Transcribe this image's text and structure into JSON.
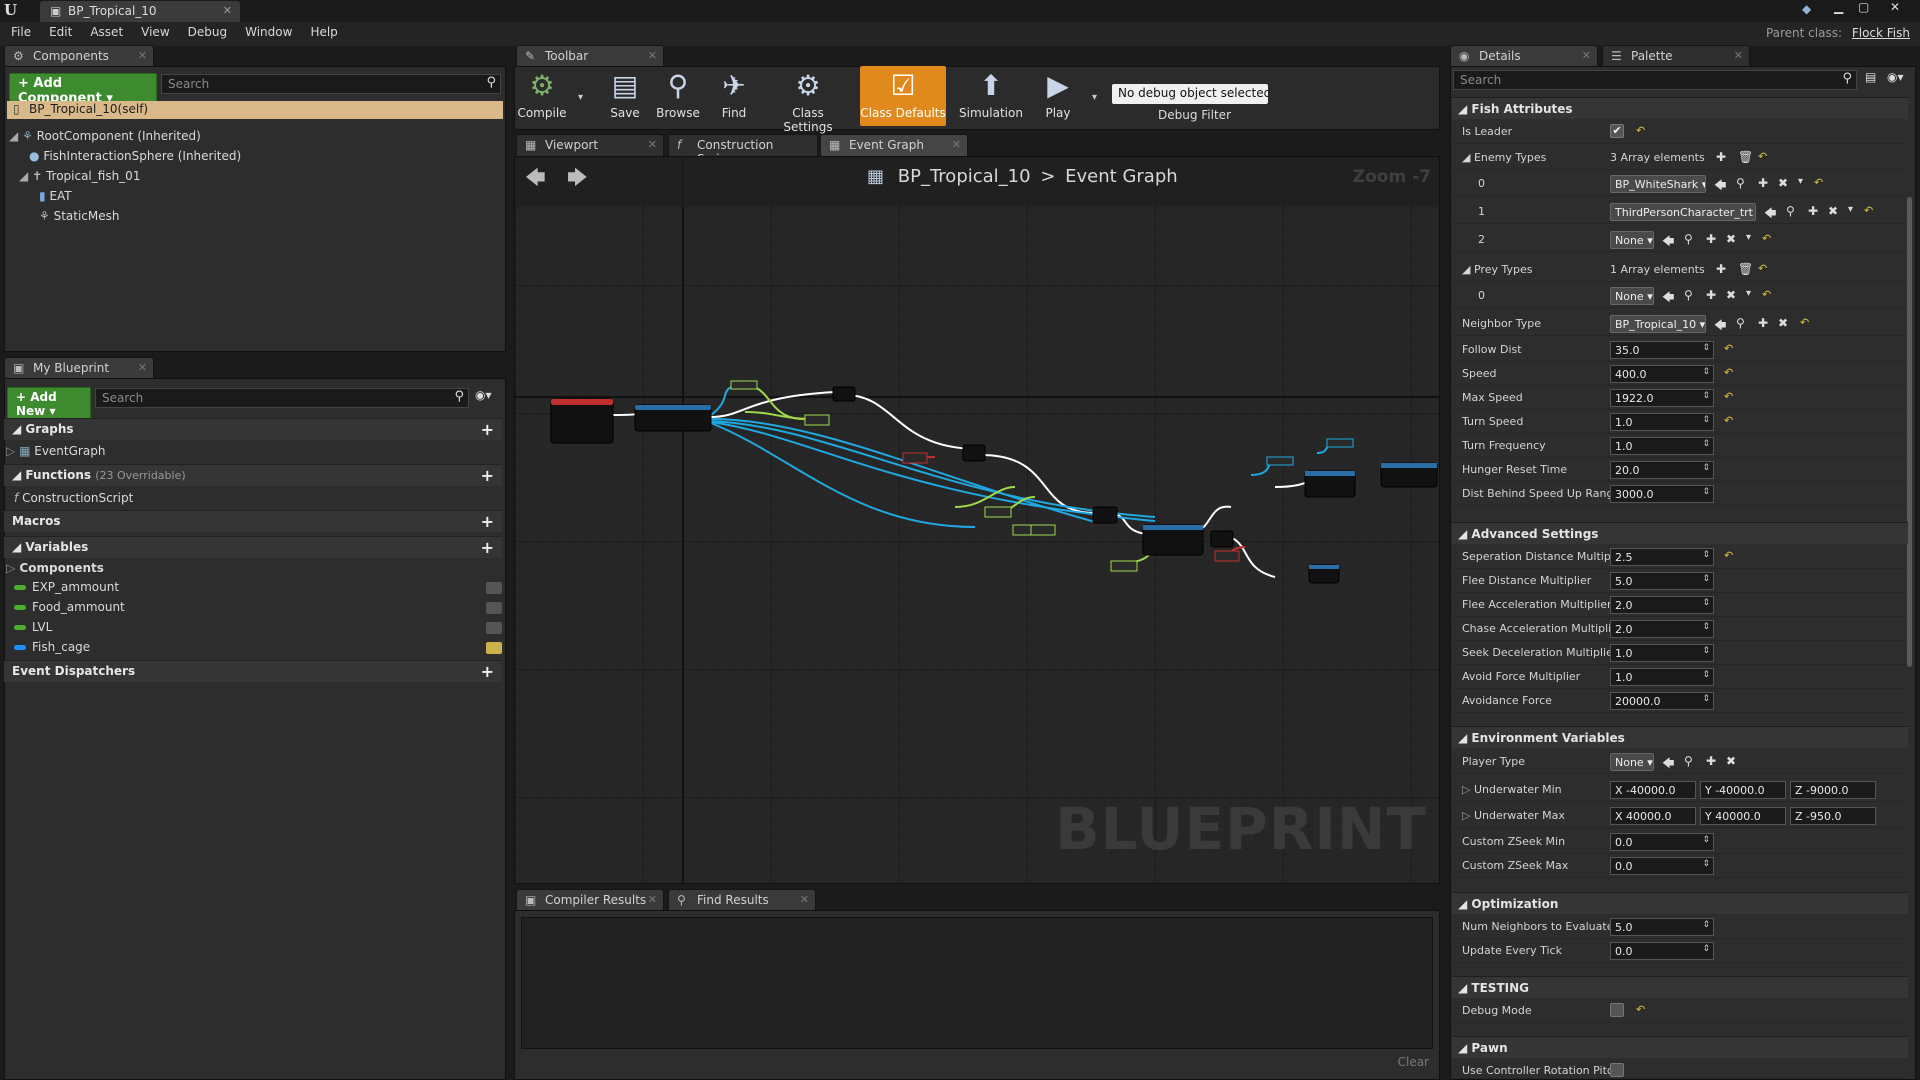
{
  "window": {
    "tab_title": "BP_Tropical_10",
    "parent_class_label": "Parent class:",
    "parent_class_value": "Flock Fish"
  },
  "menu": [
    "File",
    "Edit",
    "Asset",
    "View",
    "Debug",
    "Window",
    "Help"
  ],
  "components_panel": {
    "tab": "Components",
    "add_button": "+ Add Component ▾",
    "search_placeholder": "Search",
    "self_item": "BP_Tropical_10(self)",
    "tree": [
      "RootComponent (Inherited)",
      "FishInteractionSphere (Inherited)",
      "Tropical_fish_01",
      "EAT",
      "StaticMesh"
    ]
  },
  "my_blueprint": {
    "tab": "My Blueprint",
    "add_new": "+ Add New ▾",
    "search_placeholder": "Search",
    "graphs_label": "Graphs",
    "event_graph": "EventGraph",
    "functions_label": "Functions",
    "functions_count": "(23 Overridable)",
    "construction_script": "ConstructionScript",
    "macros_label": "Macros",
    "variables_label": "Variables",
    "components_label": "Components",
    "variables": [
      {
        "name": "EXP_ammount",
        "color": "#4caf2e"
      },
      {
        "name": "Food_ammount",
        "color": "#4caf2e"
      },
      {
        "name": "LVL",
        "color": "#4caf2e"
      },
      {
        "name": "Fish_cage",
        "color": "#1e90ff"
      }
    ],
    "event_dispatchers_label": "Event Dispatchers"
  },
  "toolbar": {
    "tab": "Toolbar",
    "buttons": [
      "Compile",
      "Save",
      "Browse",
      "Find",
      "Class Settings",
      "Class Defaults",
      "Simulation",
      "Play"
    ],
    "debug_select": "No debug object selected ▾",
    "debug_filter_label": "Debug Filter"
  },
  "graph_tabs": [
    "Viewport",
    "Construction Scrip",
    "Event Graph"
  ],
  "graph": {
    "breadcrumb_root": "BP_Tropical_10",
    "breadcrumb_sep": ">",
    "breadcrumb_leaf": "Event Graph",
    "zoom": "Zoom -7",
    "watermark": "BLUEPRINT"
  },
  "bottom_tabs": [
    "Compiler Results",
    "Find Results"
  ],
  "bottom_clear": "Clear",
  "details": {
    "tab_details": "Details",
    "tab_palette": "Palette",
    "search_placeholder": "Search",
    "sections": {
      "fish_attributes": "Fish Attributes",
      "advanced_settings": "Advanced Settings",
      "environment_variables": "Environment Variables",
      "optimization": "Optimization",
      "testing": "TESTING",
      "pawn": "Pawn"
    },
    "is_leader_label": "Is Leader",
    "enemy_types_label": "Enemy Types",
    "enemy_types_count": "3 Array elements",
    "enemy_items": [
      {
        "index": "0",
        "value": "BP_WhiteShark ▾"
      },
      {
        "index": "1",
        "value": "ThirdPersonCharacter_trt ▾"
      },
      {
        "index": "2",
        "value": "None ▾"
      }
    ],
    "prey_types_label": "Prey Types",
    "prey_types_count": "1 Array elements",
    "prey_items": [
      {
        "index": "0",
        "value": "None ▾"
      }
    ],
    "neighbor_type_label": "Neighbor Type",
    "neighbor_type_value": "BP_Tropical_10 ▾",
    "fish_numbers": [
      {
        "label": "Follow Dist",
        "value": "35.0"
      },
      {
        "label": "Speed",
        "value": "400.0"
      },
      {
        "label": "Max Speed",
        "value": "1922.0"
      },
      {
        "label": "Turn Speed",
        "value": "1.0"
      },
      {
        "label": "Turn Frequency",
        "value": "1.0"
      },
      {
        "label": "Hunger Reset Time",
        "value": "20.0"
      },
      {
        "label": "Dist Behind Speed Up Range",
        "value": "3000.0"
      }
    ],
    "advanced": [
      {
        "label": "Seperation Distance Multipli",
        "value": "2.5"
      },
      {
        "label": "Flee Distance Multiplier",
        "value": "5.0"
      },
      {
        "label": "Flee Acceleration Multiplier",
        "value": "2.0"
      },
      {
        "label": "Chase Acceleration Multiplie",
        "value": "2.0"
      },
      {
        "label": "Seek Deceleration Multiplier",
        "value": "1.0"
      },
      {
        "label": "Avoid Force Multiplier",
        "value": "1.0"
      },
      {
        "label": "Avoidance Force",
        "value": "20000.0"
      }
    ],
    "player_type_label": "Player Type",
    "player_type_value": "None ▾",
    "underwater_min_label": "Underwater Min",
    "underwater_min": [
      "X -40000.0",
      "Y -40000.0",
      "Z -9000.0"
    ],
    "underwater_max_label": "Underwater Max",
    "underwater_max": [
      "X 40000.0",
      "Y 40000.0",
      "Z -950.0"
    ],
    "zseek": [
      {
        "label": "Custom ZSeek Min",
        "value": "0.0"
      },
      {
        "label": "Custom ZSeek Max",
        "value": "0.0"
      }
    ],
    "optimization_rows": [
      {
        "label": "Num Neighbors to Evaluate",
        "value": "5.0"
      },
      {
        "label": "Update Every Tick",
        "value": "0.0"
      }
    ],
    "debug_mode_label": "Debug Mode",
    "pawn_row_label": "Use Controller Rotation Pitcl"
  }
}
